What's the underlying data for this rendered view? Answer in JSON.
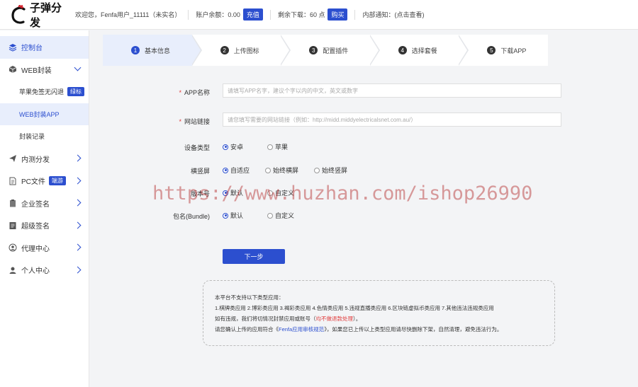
{
  "header": {
    "logo_text": "子弹分发",
    "welcome": "欢迎您，Fenfa用户_11111（未实名）",
    "balance_label": "账户余额：0.00",
    "recharge_button": "充值",
    "downloads_label": "剩余下载：60 点",
    "buy_button": "购买",
    "notice_label": "内部通知：(点击查看)"
  },
  "sidebar": {
    "items": [
      {
        "label": "控制台",
        "icon": "layers-icon"
      },
      {
        "label": "WEB封装",
        "icon": "box-icon"
      },
      {
        "label": "苹果免签无闪退",
        "badge": "绿标"
      },
      {
        "label": "WEB封装APP"
      },
      {
        "label": "封装记录"
      },
      {
        "label": "内测分发",
        "icon": "paper-plane-icon"
      },
      {
        "label": "PC文件",
        "icon": "file-icon",
        "badge": "端游"
      },
      {
        "label": "企业签名",
        "icon": "clipboard-icon"
      },
      {
        "label": "超级签名",
        "icon": "certificate-icon"
      },
      {
        "label": "代理中心",
        "icon": "agent-icon"
      },
      {
        "label": "个人中心",
        "icon": "user-icon"
      }
    ]
  },
  "steps": [
    {
      "num": "1",
      "label": "基本信息"
    },
    {
      "num": "2",
      "label": "上传图标"
    },
    {
      "num": "3",
      "label": "配置插件"
    },
    {
      "num": "4",
      "label": "选择套餐"
    },
    {
      "num": "5",
      "label": "下载APP"
    }
  ],
  "form": {
    "app_name_label": "APP名称",
    "app_name_placeholder": "请填写APP名字，建议个字以内的中文，英文或数字",
    "url_label": "网站链接",
    "url_placeholder": "请您填写需要的网站链接（例如：http://midd.middyelectricalsnet.com.au/）",
    "device_label": "设备类型",
    "device_options": [
      "安卓",
      "苹果"
    ],
    "orientation_label": "横竖屏",
    "orientation_options": [
      "自适应",
      "始终横屏",
      "始终竖屏"
    ],
    "version_label": "版本号",
    "version_options": [
      "默认",
      "自定义"
    ],
    "bundle_label": "包名(Bundle)",
    "bundle_options": [
      "默认",
      "自定义"
    ],
    "next_button": "下一步"
  },
  "notice": {
    "title": "本平台不支持以下类型应用：",
    "line1": "1.棋牌类应用 2.博彩类应用 3.褐彩类应用 4.色情类应用 5.违规直播类应用 6.区块链虚拟币类应用 7.其他违法违规类应用",
    "line2_a": "如有违规，我们将切情况封禁应用或账号（",
    "line2_red": "均不做退款处理",
    "line2_b": "）。",
    "line3_a": "请您确认上传的应用符合《",
    "line3_link": "Fenfa应用审核规范",
    "line3_b": "》，如果您已上传以上类型应用请尽快删除下架，自然清理，避免违法行为。"
  },
  "watermark": "https://www.huzhan.com/ishop26990"
}
